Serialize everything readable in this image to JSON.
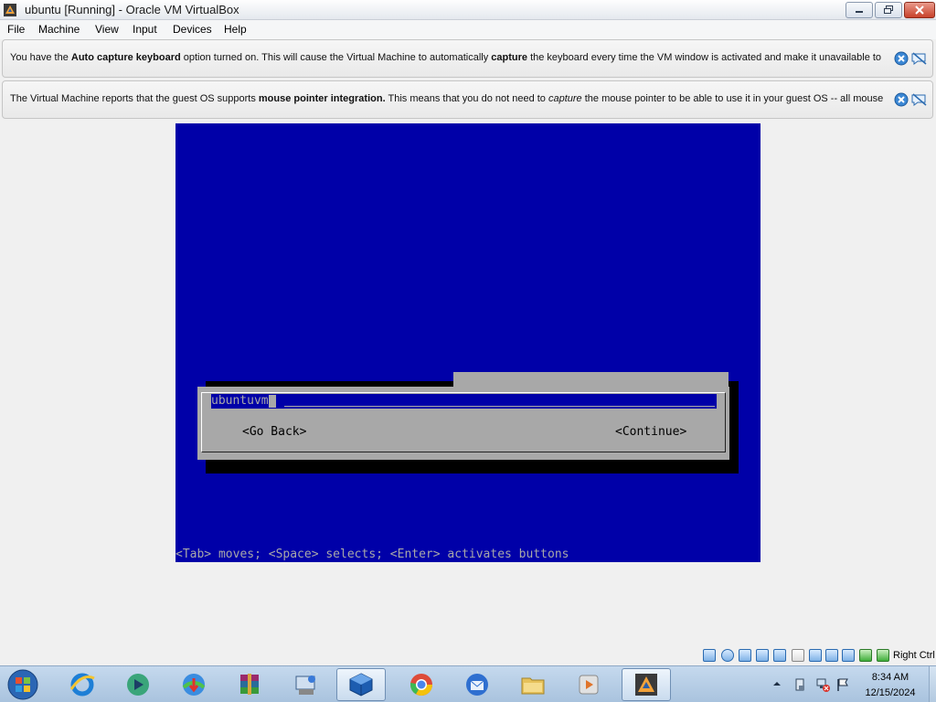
{
  "window": {
    "title": "ubuntu [Running] - Oracle VM VirtualBox",
    "app_icon": "virtualbox-icon"
  },
  "menu": {
    "items": [
      "File",
      "Machine",
      "View",
      "Input",
      "Devices",
      "Help"
    ]
  },
  "banners": [
    {
      "segments": [
        {
          "t": "You have the ",
          "s": ""
        },
        {
          "t": "Auto capture keyboard",
          "s": "b"
        },
        {
          "t": " option turned on. This will cause the Virtual Machine to automatically ",
          "s": ""
        },
        {
          "t": "capture",
          "s": "b"
        },
        {
          "t": " the keyboard every time the VM window is activated and make it unavailable to",
          "s": ""
        }
      ]
    },
    {
      "segments": [
        {
          "t": "The Virtual Machine reports that the guest OS supports ",
          "s": ""
        },
        {
          "t": "mouse pointer integration.",
          "s": "b"
        },
        {
          "t": " This means that you do not need to ",
          "s": ""
        },
        {
          "t": "capture",
          "s": "i"
        },
        {
          "t": " the mouse pointer to be able to use it in your guest OS -- all mouse",
          "s": ""
        }
      ]
    }
  ],
  "guest": {
    "hostname_value": "ubuntuvm",
    "go_back": "<Go Back>",
    "continue": "<Continue>",
    "status_line": "<Tab> moves; <Space> selects; <Enter> activates buttons"
  },
  "vbox_status": {
    "host_key": "Right Ctrl",
    "icons": [
      "hard-disk-icon",
      "optical-drive-icon",
      "audio-icon",
      "network-icon",
      "usb-icon",
      "shared-folders-icon",
      "display-icon",
      "video-capture-icon",
      "cpu-icon",
      "mouse-integration-icon",
      "keyboard-capture-icon"
    ]
  },
  "taskbar": {
    "time": "8:34 AM",
    "date": "12/15/2024",
    "apps": [
      "internet-explorer-icon",
      "media-player-icon",
      "download-manager-icon",
      "winrar-icon",
      "setup-icon",
      "virtualbox-icon",
      "chrome-icon",
      "thunderbird-icon",
      "file-explorer-icon",
      "media-classic-icon",
      "virtualbox-vm-icon"
    ]
  },
  "colors": {
    "guest_bg": "#0000a8",
    "dialog_gray": "#a8a8a8"
  }
}
